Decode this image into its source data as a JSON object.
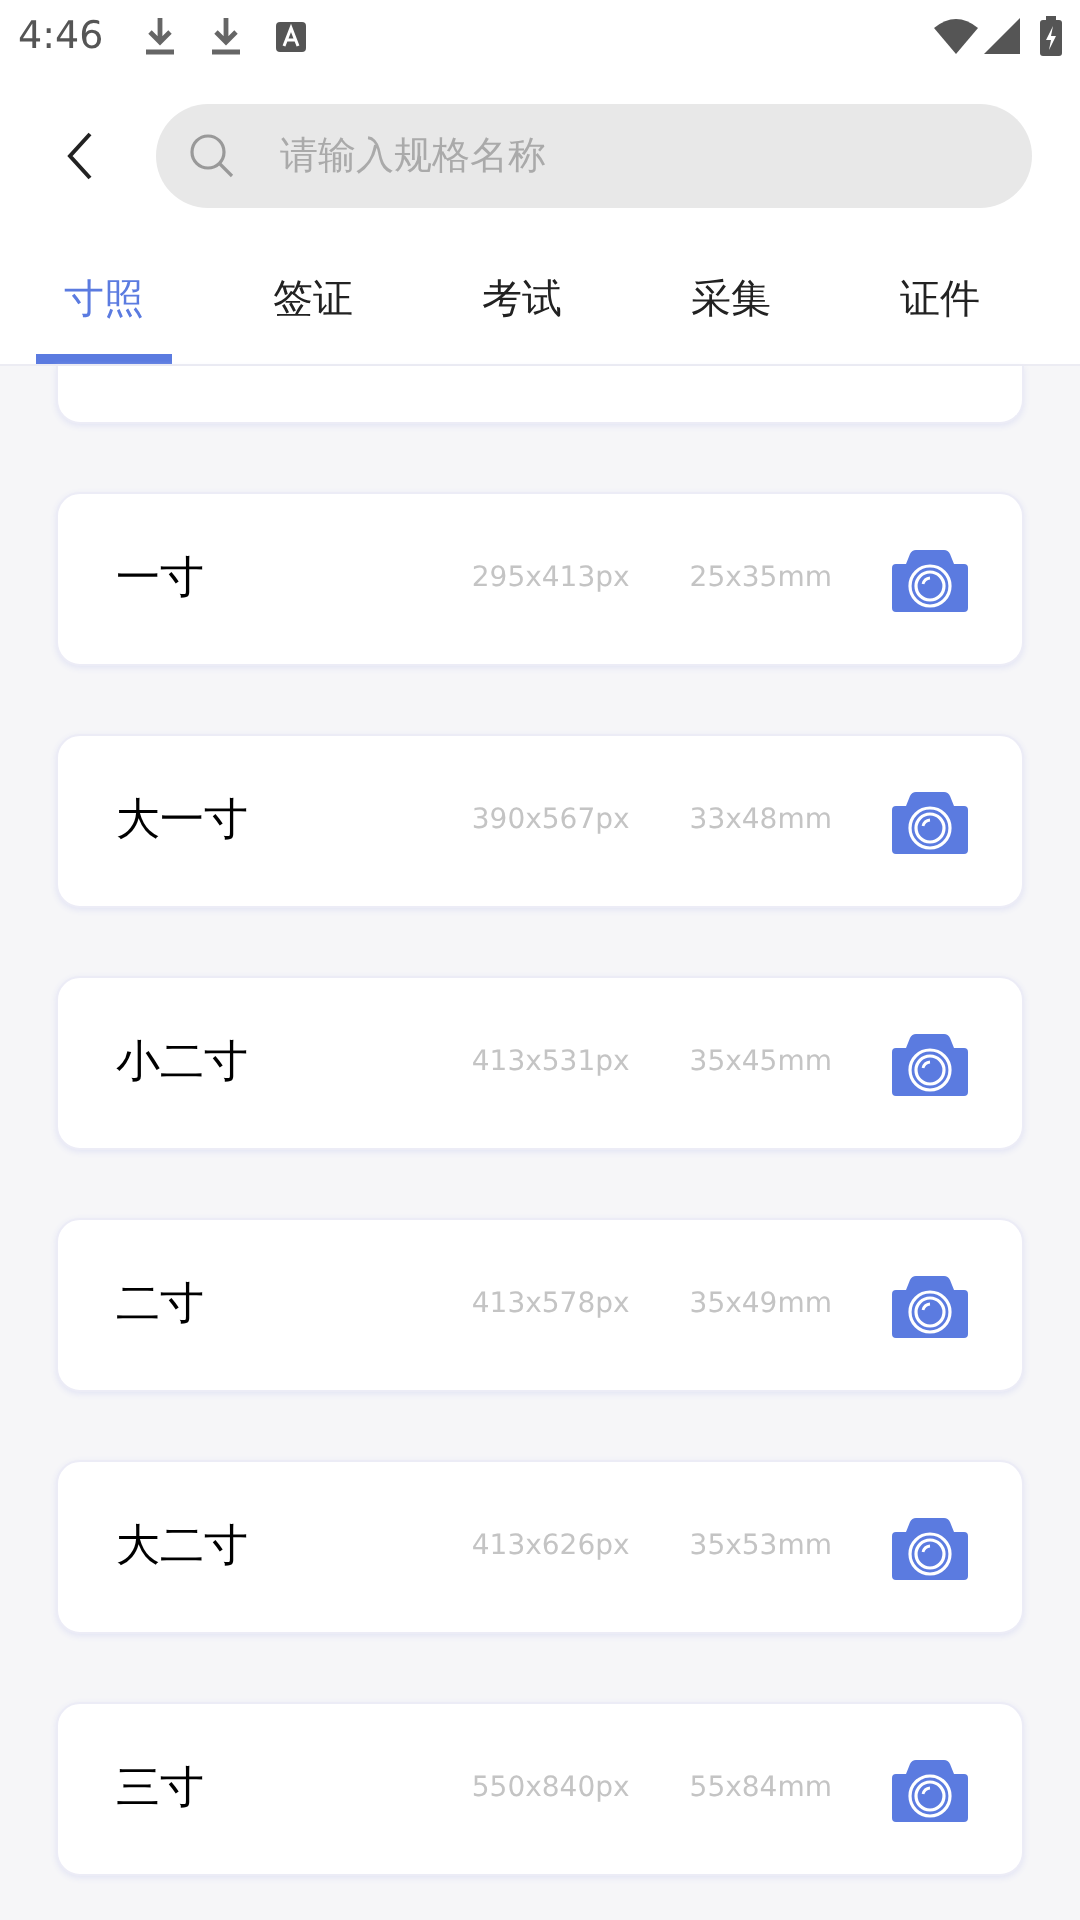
{
  "status_bar": {
    "time": "4:46"
  },
  "search": {
    "placeholder": "请输入规格名称"
  },
  "tabs": [
    {
      "label": "寸照",
      "selected": true
    },
    {
      "label": "签证",
      "selected": false
    },
    {
      "label": "考试",
      "selected": false
    },
    {
      "label": "采集",
      "selected": false
    },
    {
      "label": "证件",
      "selected": false
    }
  ],
  "specs": [
    {
      "name": "一寸",
      "pixels": "295x413px",
      "size": "25x35mm"
    },
    {
      "name": "大一寸",
      "pixels": "390x567px",
      "size": "33x48mm"
    },
    {
      "name": "小二寸",
      "pixels": "413x531px",
      "size": "35x45mm"
    },
    {
      "name": "二寸",
      "pixels": "413x578px",
      "size": "35x49mm"
    },
    {
      "name": "大二寸",
      "pixels": "413x626px",
      "size": "35x53mm"
    },
    {
      "name": "三寸",
      "pixels": "550x840px",
      "size": "55x84mm"
    }
  ]
}
